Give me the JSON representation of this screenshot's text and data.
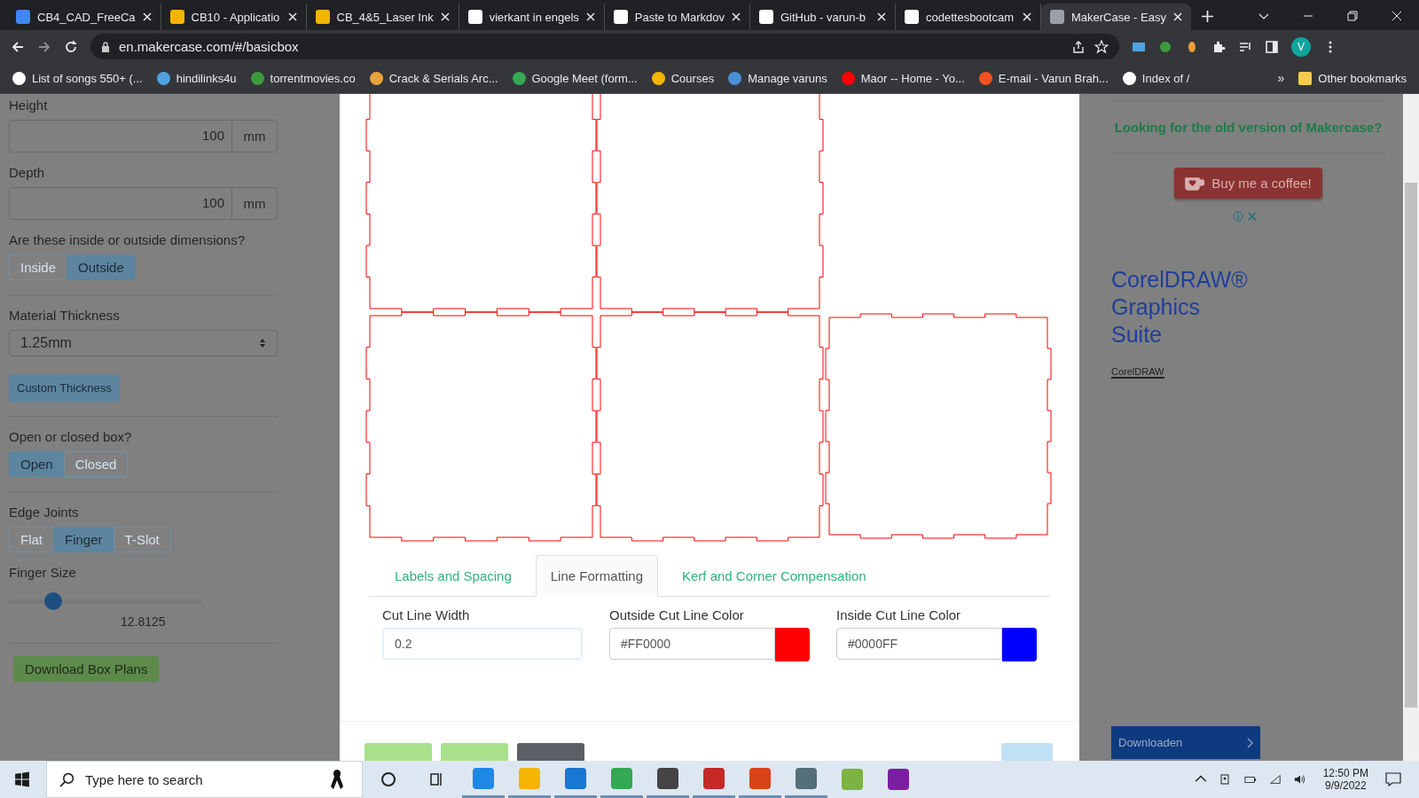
{
  "browser": {
    "tabs": [
      {
        "title": "CB4_CAD_FreeCa",
        "selected": false
      },
      {
        "title": "CB10 - Applicatio",
        "selected": false
      },
      {
        "title": "CB_4&5_Laser Ink",
        "selected": false
      },
      {
        "title": "vierkant in engels",
        "selected": false
      },
      {
        "title": "Paste to Markdov",
        "selected": false
      },
      {
        "title": "GitHub - varun-b",
        "selected": false
      },
      {
        "title": "codettesbootcam",
        "selected": false
      },
      {
        "title": "MakerCase - Easy",
        "selected": true
      }
    ],
    "address": "en.makercase.com/#/basicbox",
    "profile_initial": "V",
    "bookmarks": [
      "List of songs 550+ (...",
      "hindilinks4u",
      "torrentmovies.co",
      "Crack & Serials Arc...",
      "Google Meet (form...",
      "Courses",
      "Manage varuns",
      "Maor -- Home - Yo...",
      "E-mail - Varun Brah...",
      "Index of /"
    ],
    "more_bookmarks": "»",
    "other_bookmarks": "Other bookmarks"
  },
  "left_panel": {
    "height": {
      "label": "Height",
      "value": "100",
      "unit": "mm"
    },
    "depth": {
      "label": "Depth",
      "value": "100",
      "unit": "mm"
    },
    "dimensions": {
      "label": "Are these inside or outside dimensions?",
      "options": [
        {
          "label": "Inside",
          "selected": false
        },
        {
          "label": "Outside",
          "selected": true
        }
      ]
    },
    "material_thickness": {
      "label": "Material Thickness",
      "value": "1.25mm"
    },
    "custom_thickness_button": "Custom Thickness",
    "open_closed": {
      "label": "Open or closed box?",
      "options": [
        {
          "label": "Open",
          "selected": true
        },
        {
          "label": "Closed",
          "selected": false
        }
      ]
    },
    "edge_joints": {
      "label": "Edge Joints",
      "options": [
        {
          "label": "Flat",
          "selected": false
        },
        {
          "label": "Finger",
          "selected": true
        },
        {
          "label": "T-Slot",
          "selected": false
        }
      ]
    },
    "finger_size": {
      "label": "Finger Size",
      "level": 0.23,
      "reading": "12.8125"
    },
    "download_button": "Download Box Plans"
  },
  "modal": {
    "tabs": [
      {
        "label": "Labels and Spacing",
        "selected": false
      },
      {
        "label": "Line Formatting",
        "selected": true
      },
      {
        "label": "Kerf and Corner Compensation",
        "selected": false
      }
    ],
    "cut_line_width": {
      "label": "Cut Line Width",
      "value": "0.2"
    },
    "color_fields": [
      {
        "label": "Outside Cut Line Color",
        "value": "#FF0000",
        "color": "#ff0000"
      },
      {
        "label": "Inside Cut Line Color",
        "value": "#0000FF",
        "color": "#0000ff"
      }
    ],
    "footer_buttons": [
      {
        "kind": "success"
      },
      {
        "kind": "success"
      },
      {
        "kind": "dark"
      },
      {
        "kind": "info"
      }
    ]
  },
  "right_panel": {
    "old_version_link": "Looking for the old version of Makercase?",
    "coffee_button": "Buy me a coffee!",
    "ad": {
      "title": "CorelDRAW® Graphics Suite",
      "brand": "CorelDRAW",
      "cta": "Downloaden"
    }
  },
  "taskbar": {
    "search_placeholder": "Type here to search",
    "time": "12:50 PM",
    "date": "9/9/2022"
  }
}
